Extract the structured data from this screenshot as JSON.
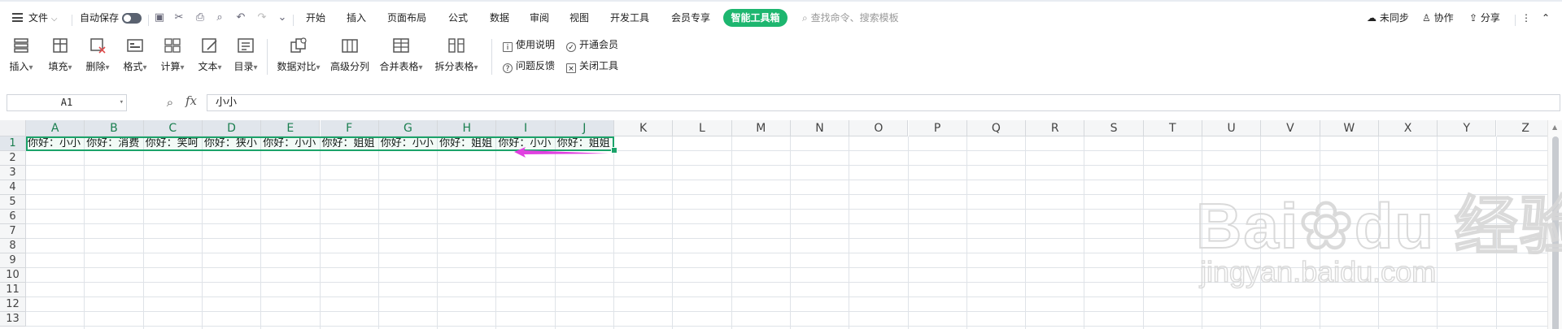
{
  "menubar": {
    "file_label": "文件",
    "autosave_label": "自动保存",
    "tabs": [
      "开始",
      "插入",
      "页面布局",
      "公式",
      "数据",
      "审阅",
      "视图",
      "开发工具",
      "会员专享"
    ],
    "active_tab": "智能工具箱",
    "search_placeholder": "查找命令、搜索模板",
    "unsynced_label": "未同步",
    "collab_label": "协作",
    "share_label": "分享"
  },
  "ribbon": {
    "buttons": [
      "插入",
      "填充",
      "删除",
      "格式",
      "计算",
      "文本",
      "目录",
      "数据对比",
      "高级分列",
      "合并表格",
      "拆分表格"
    ],
    "help_label": "使用说明",
    "member_label": "开通会员",
    "feedback_label": "问题反馈",
    "close_label": "关闭工具"
  },
  "formula_bar": {
    "cell_ref": "A1",
    "fx": "fx",
    "content": "小小"
  },
  "sheet": {
    "columns": [
      "A",
      "B",
      "C",
      "D",
      "E",
      "F",
      "G",
      "H",
      "I",
      "J",
      "K",
      "L",
      "M",
      "N",
      "O",
      "P",
      "Q",
      "R",
      "S",
      "T",
      "U",
      "V",
      "W",
      "X",
      "Y",
      "Z"
    ],
    "rows": [
      "1",
      "2",
      "3",
      "4",
      "5",
      "6",
      "7",
      "8",
      "9",
      "10",
      "11",
      "12",
      "13"
    ],
    "row1_cells": [
      "你好：小小",
      "你好：消费",
      "你好：笑呵",
      "你好：狭小",
      "你好：小小",
      "你好：姐姐",
      "你好：小小",
      "你好：姐姐",
      "你好：小小",
      "你好：姐姐"
    ]
  },
  "watermark": {
    "brand": "Bai",
    "brand2": "du",
    "cn": "经验",
    "url": "jingyan.baidu.com"
  },
  "colors": {
    "accent_green": "#1db66f",
    "selection_border": "#1ba36a",
    "arrow": "#e040e0"
  }
}
